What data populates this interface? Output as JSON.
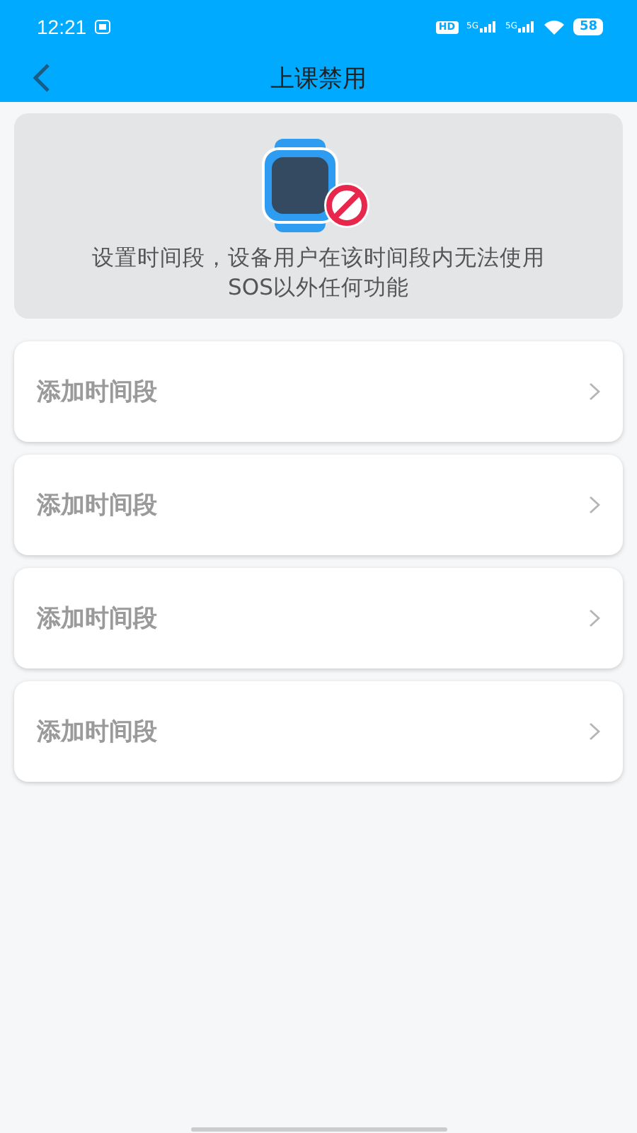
{
  "status_bar": {
    "time": "12:21",
    "hd_label": "HD",
    "network_labels": [
      "5G",
      "5G"
    ],
    "battery": "58"
  },
  "header": {
    "title": "上课禁用"
  },
  "info": {
    "description": "设置时间段，设备用户在该时间段内无法使用SOS以外任何功能"
  },
  "periods": [
    {
      "label": "添加时间段"
    },
    {
      "label": "添加时间段"
    },
    {
      "label": "添加时间段"
    },
    {
      "label": "添加时间段"
    }
  ]
}
